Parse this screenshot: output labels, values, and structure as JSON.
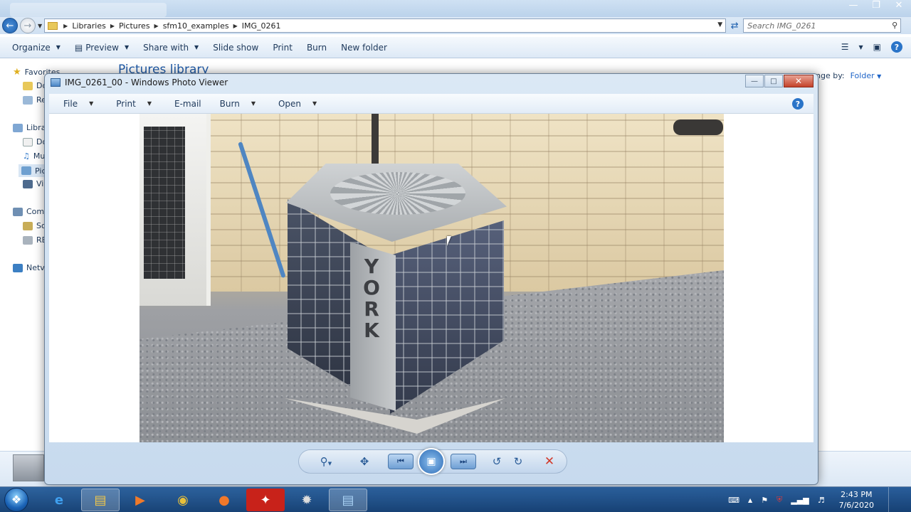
{
  "explorer": {
    "breadcrumb": [
      "Libraries",
      "Pictures",
      "sfm10_examples",
      "IMG_0261"
    ],
    "search_placeholder": "Search IMG_0261",
    "toolbar": {
      "organize": "Organize",
      "preview": "Preview",
      "share_with": "Share with",
      "slide_show": "Slide show",
      "print": "Print",
      "burn": "Burn",
      "new_folder": "New folder"
    },
    "nav": {
      "favorites": "Favorites",
      "fav_items": [
        "Do",
        "Re"
      ],
      "libraries": "Libra",
      "lib_items": [
        "Do",
        "Mu",
        "Pic",
        "Vic"
      ],
      "computer": "Com",
      "comp_items": [
        "Sof",
        "RE"
      ],
      "network": "Netv"
    },
    "library_header": "Pictures library",
    "arrange_label": "nge by:",
    "arrange_value": "Folder"
  },
  "viewer": {
    "title": "IMG_0261_00 - Windows Photo Viewer",
    "menu": {
      "file": "File",
      "print": "Print",
      "email": "E-mail",
      "burn": "Burn",
      "open": "Open"
    },
    "photo_brand_letters": [
      "Y",
      "O",
      "R",
      "K"
    ]
  },
  "taskbar": {
    "time": "2:43 PM",
    "date": "7/6/2020"
  },
  "colors": {
    "accent": "#1e64c8",
    "close_red": "#c4422a",
    "taskbar_blue": "#1f4f8a"
  }
}
